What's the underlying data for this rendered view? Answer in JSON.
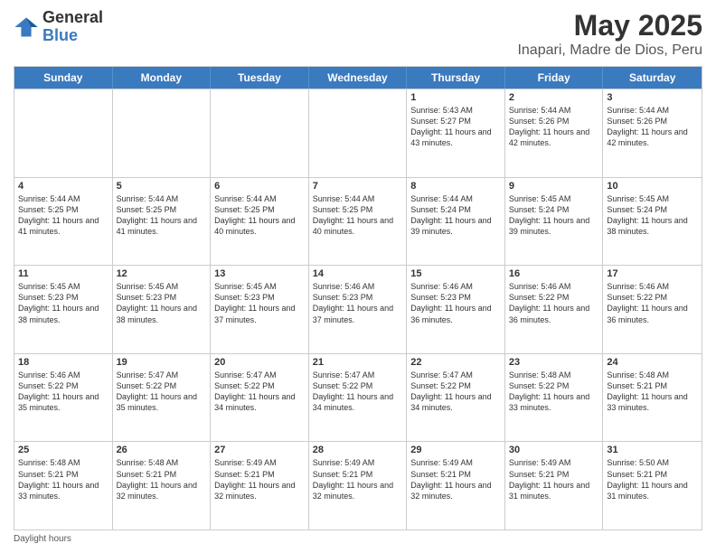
{
  "header": {
    "logo_general": "General",
    "logo_blue": "Blue",
    "title": "May 2025",
    "subtitle": "Inapari, Madre de Dios, Peru"
  },
  "calendar": {
    "days": [
      "Sunday",
      "Monday",
      "Tuesday",
      "Wednesday",
      "Thursday",
      "Friday",
      "Saturday"
    ],
    "weeks": [
      [
        {
          "day": "",
          "content": ""
        },
        {
          "day": "",
          "content": ""
        },
        {
          "day": "",
          "content": ""
        },
        {
          "day": "",
          "content": ""
        },
        {
          "day": "1",
          "content": "Sunrise: 5:43 AM\nSunset: 5:27 PM\nDaylight: 11 hours and 43 minutes."
        },
        {
          "day": "2",
          "content": "Sunrise: 5:44 AM\nSunset: 5:26 PM\nDaylight: 11 hours and 42 minutes."
        },
        {
          "day": "3",
          "content": "Sunrise: 5:44 AM\nSunset: 5:26 PM\nDaylight: 11 hours and 42 minutes."
        }
      ],
      [
        {
          "day": "4",
          "content": "Sunrise: 5:44 AM\nSunset: 5:25 PM\nDaylight: 11 hours and 41 minutes."
        },
        {
          "day": "5",
          "content": "Sunrise: 5:44 AM\nSunset: 5:25 PM\nDaylight: 11 hours and 41 minutes."
        },
        {
          "day": "6",
          "content": "Sunrise: 5:44 AM\nSunset: 5:25 PM\nDaylight: 11 hours and 40 minutes."
        },
        {
          "day": "7",
          "content": "Sunrise: 5:44 AM\nSunset: 5:25 PM\nDaylight: 11 hours and 40 minutes."
        },
        {
          "day": "8",
          "content": "Sunrise: 5:44 AM\nSunset: 5:24 PM\nDaylight: 11 hours and 39 minutes."
        },
        {
          "day": "9",
          "content": "Sunrise: 5:45 AM\nSunset: 5:24 PM\nDaylight: 11 hours and 39 minutes."
        },
        {
          "day": "10",
          "content": "Sunrise: 5:45 AM\nSunset: 5:24 PM\nDaylight: 11 hours and 38 minutes."
        }
      ],
      [
        {
          "day": "11",
          "content": "Sunrise: 5:45 AM\nSunset: 5:23 PM\nDaylight: 11 hours and 38 minutes."
        },
        {
          "day": "12",
          "content": "Sunrise: 5:45 AM\nSunset: 5:23 PM\nDaylight: 11 hours and 38 minutes."
        },
        {
          "day": "13",
          "content": "Sunrise: 5:45 AM\nSunset: 5:23 PM\nDaylight: 11 hours and 37 minutes."
        },
        {
          "day": "14",
          "content": "Sunrise: 5:46 AM\nSunset: 5:23 PM\nDaylight: 11 hours and 37 minutes."
        },
        {
          "day": "15",
          "content": "Sunrise: 5:46 AM\nSunset: 5:23 PM\nDaylight: 11 hours and 36 minutes."
        },
        {
          "day": "16",
          "content": "Sunrise: 5:46 AM\nSunset: 5:22 PM\nDaylight: 11 hours and 36 minutes."
        },
        {
          "day": "17",
          "content": "Sunrise: 5:46 AM\nSunset: 5:22 PM\nDaylight: 11 hours and 36 minutes."
        }
      ],
      [
        {
          "day": "18",
          "content": "Sunrise: 5:46 AM\nSunset: 5:22 PM\nDaylight: 11 hours and 35 minutes."
        },
        {
          "day": "19",
          "content": "Sunrise: 5:47 AM\nSunset: 5:22 PM\nDaylight: 11 hours and 35 minutes."
        },
        {
          "day": "20",
          "content": "Sunrise: 5:47 AM\nSunset: 5:22 PM\nDaylight: 11 hours and 34 minutes."
        },
        {
          "day": "21",
          "content": "Sunrise: 5:47 AM\nSunset: 5:22 PM\nDaylight: 11 hours and 34 minutes."
        },
        {
          "day": "22",
          "content": "Sunrise: 5:47 AM\nSunset: 5:22 PM\nDaylight: 11 hours and 34 minutes."
        },
        {
          "day": "23",
          "content": "Sunrise: 5:48 AM\nSunset: 5:22 PM\nDaylight: 11 hours and 33 minutes."
        },
        {
          "day": "24",
          "content": "Sunrise: 5:48 AM\nSunset: 5:21 PM\nDaylight: 11 hours and 33 minutes."
        }
      ],
      [
        {
          "day": "25",
          "content": "Sunrise: 5:48 AM\nSunset: 5:21 PM\nDaylight: 11 hours and 33 minutes."
        },
        {
          "day": "26",
          "content": "Sunrise: 5:48 AM\nSunset: 5:21 PM\nDaylight: 11 hours and 32 minutes."
        },
        {
          "day": "27",
          "content": "Sunrise: 5:49 AM\nSunset: 5:21 PM\nDaylight: 11 hours and 32 minutes."
        },
        {
          "day": "28",
          "content": "Sunrise: 5:49 AM\nSunset: 5:21 PM\nDaylight: 11 hours and 32 minutes."
        },
        {
          "day": "29",
          "content": "Sunrise: 5:49 AM\nSunset: 5:21 PM\nDaylight: 11 hours and 32 minutes."
        },
        {
          "day": "30",
          "content": "Sunrise: 5:49 AM\nSunset: 5:21 PM\nDaylight: 11 hours and 31 minutes."
        },
        {
          "day": "31",
          "content": "Sunrise: 5:50 AM\nSunset: 5:21 PM\nDaylight: 11 hours and 31 minutes."
        }
      ]
    ]
  },
  "footer": {
    "daylight_label": "Daylight hours"
  }
}
